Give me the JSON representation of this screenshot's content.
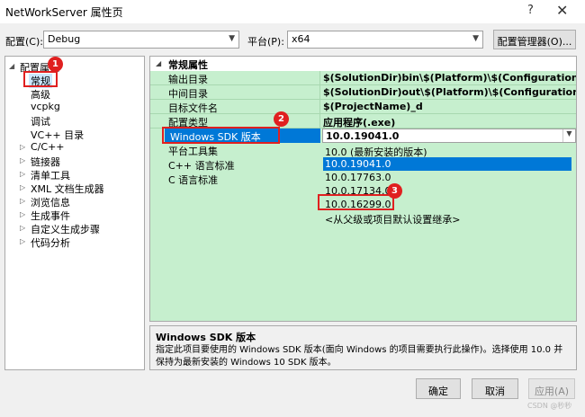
{
  "window": {
    "title": "NetWorkServer 属性页",
    "help": "?",
    "close": "✕"
  },
  "config": {
    "config_label": "配置(C):",
    "config_value": "Debug",
    "platform_label": "平台(P):",
    "platform_value": "x64",
    "manager_button": "配置管理器(O)..."
  },
  "tree": {
    "root": "配置属性",
    "items": [
      {
        "label": "常规",
        "expandable": false,
        "selected": true
      },
      {
        "label": "高级",
        "expandable": false
      },
      {
        "label": "vcpkg",
        "expandable": false
      },
      {
        "label": "调试",
        "expandable": false
      },
      {
        "label": "VC++ 目录",
        "expandable": false
      },
      {
        "label": "C/C++",
        "expandable": true
      },
      {
        "label": "链接器",
        "expandable": true
      },
      {
        "label": "清单工具",
        "expandable": true
      },
      {
        "label": "XML 文档生成器",
        "expandable": true
      },
      {
        "label": "浏览信息",
        "expandable": true
      },
      {
        "label": "生成事件",
        "expandable": true
      },
      {
        "label": "自定义生成步骤",
        "expandable": true
      },
      {
        "label": "代码分析",
        "expandable": true
      }
    ]
  },
  "grid": {
    "section": "常规属性",
    "rows": [
      {
        "name": "输出目录",
        "value": "$(SolutionDir)bin\\$(Platform)\\$(Configuration)\\$(proje"
      },
      {
        "name": "中间目录",
        "value": "$(SolutionDir)out\\$(Platform)\\$(Configuration)\\$(proje"
      },
      {
        "name": "目标文件名",
        "value": "$(ProjectName)_d"
      },
      {
        "name": "配置类型",
        "value": "应用程序(.exe)"
      }
    ],
    "sdk_name": "Windows SDK 版本",
    "sdk_value": "10.0.19041.0",
    "lower_rows": [
      {
        "name": "平台工具集"
      },
      {
        "name": "C++ 语言标准"
      },
      {
        "name": "C 语言标准"
      }
    ],
    "dropdown": [
      "10.0 (最新安装的版本)",
      "10.0.19041.0",
      "10.0.17763.0",
      "10.0.17134.0",
      "10.0.16299.0",
      "<从父级或项目默认设置继承>"
    ],
    "dropdown_highlight_index": 1
  },
  "description": {
    "title": "Windows SDK 版本",
    "text": "指定此项目要使用的 Windows SDK 版本(面向 Windows 的项目需要执行此操作)。选择使用 10.0 并保持为最新安装的 Windows 10 SDK 版本。"
  },
  "buttons": {
    "ok": "确定",
    "cancel": "取消",
    "apply": "应用(A)"
  },
  "callouts": [
    "1",
    "2",
    "3"
  ],
  "watermark": "CSDN @秒秒",
  "colors": {
    "accent": "#0078d7",
    "grid_bg": "#c6efce",
    "callout": "#e02020"
  }
}
